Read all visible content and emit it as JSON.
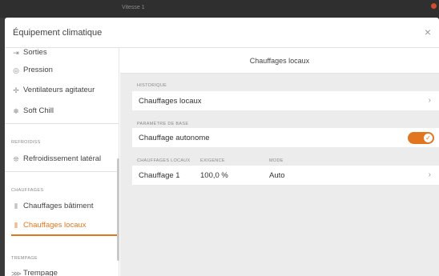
{
  "topbar": {
    "title": "Vitesse 1"
  },
  "dialog": {
    "title": "Équipement climatique",
    "close_glyph": "×"
  },
  "sidebar": {
    "items": [
      {
        "label": "Sorties",
        "icon": "outputs-icon"
      },
      {
        "label": "Pression",
        "icon": "pressure-icon"
      },
      {
        "label": "Ventilateurs agitateur",
        "icon": "fan-icon"
      },
      {
        "label": "Soft Chill",
        "icon": "soft-chill-icon"
      },
      {
        "label": "Refroidissement latéral",
        "icon": "side-cooling-icon"
      },
      {
        "label": "Chauffages bâtiment",
        "icon": "heater-icon"
      },
      {
        "label": "Chauffages locaux",
        "icon": "heater-icon"
      },
      {
        "label": "Trempage",
        "icon": "soaking-icon"
      }
    ],
    "sections": {
      "refroidiss": "REFROIDISS",
      "chauffages": "CHAUFFAGES",
      "trempage": "TREMPAGE"
    },
    "active_index": 6
  },
  "main": {
    "title": "Chauffages locaux",
    "history_section": "HISTORIQUE",
    "history_row": "Chauffages locaux",
    "base_section": "PARAMÈTRE DE BASE",
    "autonomous_label": "Chauffage autonome",
    "autonomous_on": true,
    "table": {
      "headers": [
        "CHAUFFAGES LOCAUX",
        "EXIGENCE",
        "MODE"
      ],
      "rows": [
        {
          "name": "Chauffage 1",
          "requirement": "100,0 %",
          "mode": "Auto"
        }
      ]
    },
    "chevron_glyph": "›"
  },
  "colors": {
    "accent": "#e2761f",
    "main_bg": "#ececec"
  }
}
